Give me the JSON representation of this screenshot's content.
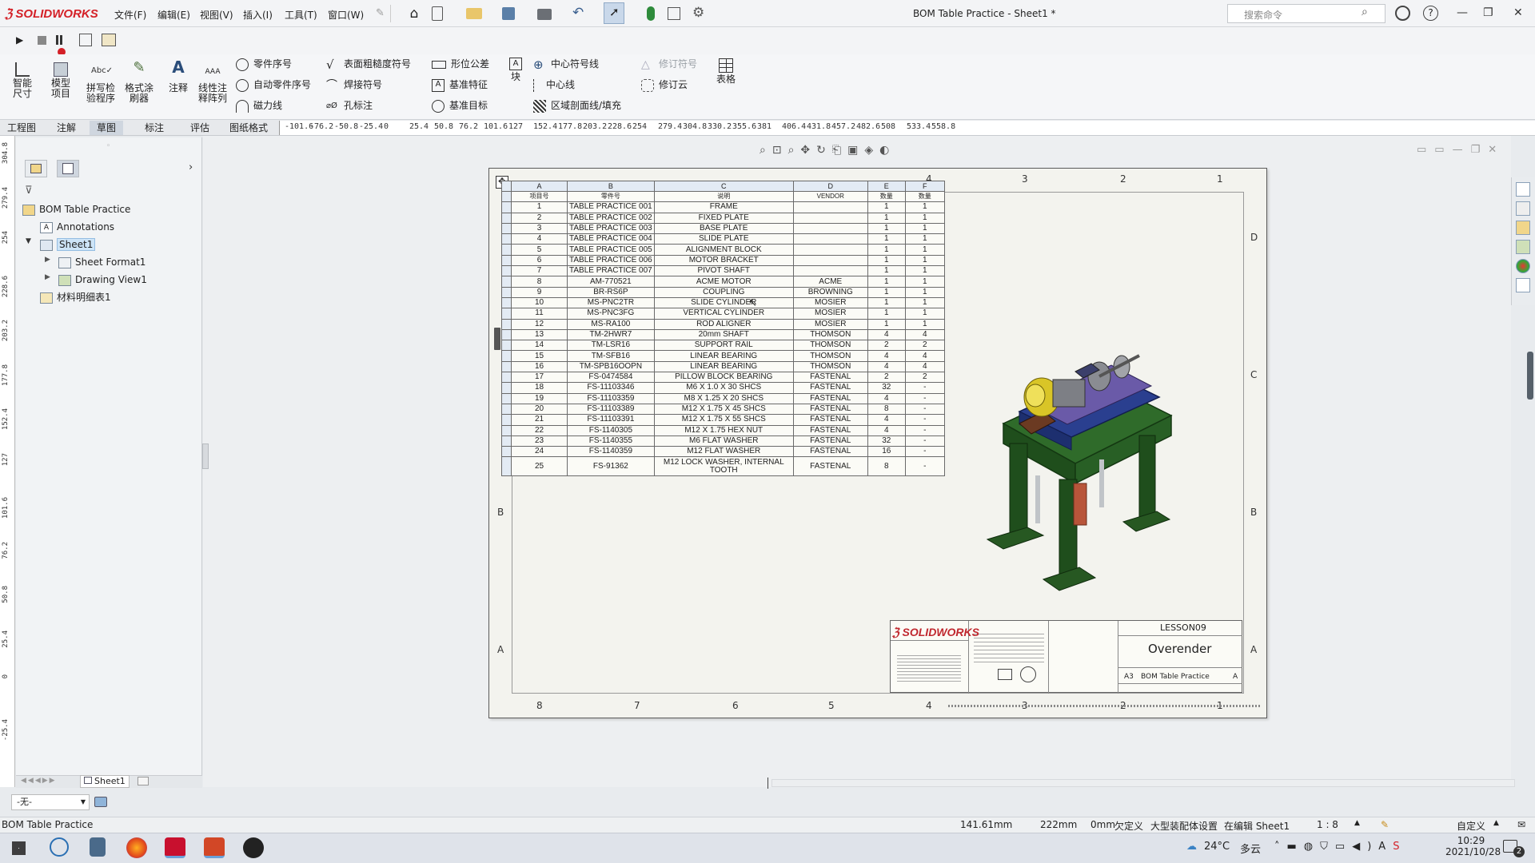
{
  "app": {
    "logo": "SOLIDWORKS",
    "title": "BOM Table Practice - Sheet1 *"
  },
  "menu": [
    "文件(F)",
    "编辑(E)",
    "视图(V)",
    "插入(I)",
    "工具(T)",
    "窗口(W)"
  ],
  "search": {
    "placeholder": "搜索命令"
  },
  "window_controls": [
    "—",
    "❐",
    "✕"
  ],
  "ribbon": {
    "big": [
      "智能尺寸",
      "模型项目",
      "拼写检验程序",
      "格式涂刷器",
      "注释",
      "线性注释阵列"
    ],
    "col1": [
      "零件序号",
      "自动零件序号",
      "磁力线"
    ],
    "col2": [
      "表面粗糙度符号",
      "焊接符号",
      "孔标注"
    ],
    "col3": [
      "形位公差",
      "基准特征",
      "基准目标"
    ],
    "block": "块",
    "col4": [
      "中心符号线",
      "中心线",
      "区域剖面线/填充"
    ],
    "col5": [
      "修订符号",
      "修订云"
    ],
    "table": "表格"
  },
  "tabs": [
    "工程图",
    "注解",
    "草图",
    "标注",
    "评估",
    "图纸格式"
  ],
  "ruler_h": [
    "-101.6",
    "-76.2",
    "-50.8",
    "-25.4",
    "0",
    "25.4",
    "50.8",
    "76.2",
    "101.6",
    "127",
    "152.4",
    "177.8",
    "203.2",
    "228.6",
    "254",
    "279.4",
    "304.8",
    "330.2",
    "355.6",
    "381",
    "406.4",
    "431.8",
    "457.2",
    "482.6",
    "508",
    "533.4",
    "558.8"
  ],
  "ruler_v": [
    "304.8",
    "279.4",
    "254",
    "228.6",
    "203.2",
    "177.8",
    "152.4",
    "127",
    "101.6",
    "76.2",
    "50.8",
    "25.4",
    "0",
    "-25.4"
  ],
  "tree": {
    "root": "BOM Table Practice",
    "annotations": "Annotations",
    "sheet": "Sheet1",
    "sheet_format": "Sheet Format1",
    "drawing_view": "Drawing View1",
    "bom": "材料明细表1"
  },
  "fm_bottom": {
    "sheet_tab": "Sheet1",
    "combo": "-无-"
  },
  "sheet_zones": {
    "top": [
      "8",
      "7",
      "6",
      "5",
      "4",
      "3",
      "2",
      "1"
    ],
    "rows": [
      "D",
      "C",
      "B",
      "A"
    ]
  },
  "bom": {
    "letters": [
      "A",
      "B",
      "C",
      "D",
      "E",
      "F"
    ],
    "headers": [
      "项目号",
      "零件号",
      "说明",
      "VENDOR",
      "数量",
      "数量"
    ],
    "rows": [
      [
        "1",
        "TABLE PRACTICE 001",
        "FRAME",
        "",
        "1",
        "1"
      ],
      [
        "2",
        "TABLE PRACTICE 002",
        "FIXED PLATE",
        "",
        "1",
        "1"
      ],
      [
        "3",
        "TABLE PRACTICE 003",
        "BASE PLATE",
        "",
        "1",
        "1"
      ],
      [
        "4",
        "TABLE PRACTICE 004",
        "SLIDE PLATE",
        "",
        "1",
        "1"
      ],
      [
        "5",
        "TABLE PRACTICE 005",
        "ALIGNMENT BLOCK",
        "",
        "1",
        "1"
      ],
      [
        "6",
        "TABLE PRACTICE 006",
        "MOTOR BRACKET",
        "",
        "1",
        "1"
      ],
      [
        "7",
        "TABLE PRACTICE 007",
        "PIVOT SHAFT",
        "",
        "1",
        "1"
      ],
      [
        "8",
        "AM-770521",
        "ACME MOTOR",
        "ACME",
        "1",
        "1"
      ],
      [
        "9",
        "BR-RS6P",
        "COUPLING",
        "BROWNING",
        "1",
        "1"
      ],
      [
        "10",
        "MS-PNC2TR",
        "SLIDE CYLINDER",
        "MOSIER",
        "1",
        "1"
      ],
      [
        "11",
        "MS-PNC3FG",
        "VERTICAL CYLINDER",
        "MOSIER",
        "1",
        "1"
      ],
      [
        "12",
        "MS-RA100",
        "ROD ALIGNER",
        "MOSIER",
        "1",
        "1"
      ],
      [
        "13",
        "TM-2HWR7",
        "20mm SHAFT",
        "THOMSON",
        "4",
        "4"
      ],
      [
        "14",
        "TM-LSR16",
        "SUPPORT RAIL",
        "THOMSON",
        "2",
        "2"
      ],
      [
        "15",
        "TM-SFB16",
        "LINEAR BEARING",
        "THOMSON",
        "4",
        "4"
      ],
      [
        "16",
        "TM-SPB16OOPN",
        "LINEAR BEARING",
        "THOMSON",
        "4",
        "4"
      ],
      [
        "17",
        "FS-0474584",
        "PILLOW BLOCK BEARING",
        "FASTENAL",
        "2",
        "2"
      ],
      [
        "18",
        "FS-11103346",
        "M6 X 1.0 X 30 SHCS",
        "FASTENAL",
        "32",
        "-"
      ],
      [
        "19",
        "FS-11103359",
        "M8 X 1.25 X 20 SHCS",
        "FASTENAL",
        "4",
        "-"
      ],
      [
        "20",
        "FS-11103389",
        "M12 X 1.75 X 45 SHCS",
        "FASTENAL",
        "8",
        "-"
      ],
      [
        "21",
        "FS-11103391",
        "M12 X 1.75 X 55 SHCS",
        "FASTENAL",
        "4",
        "-"
      ],
      [
        "22",
        "FS-1140305",
        "M12 X 1.75 HEX NUT",
        "FASTENAL",
        "4",
        "-"
      ],
      [
        "23",
        "FS-1140355",
        "M6 FLAT WASHER",
        "FASTENAL",
        "32",
        "-"
      ],
      [
        "24",
        "FS-1140359",
        "M12 FLAT WASHER",
        "FASTENAL",
        "16",
        "-"
      ],
      [
        "25",
        "FS-91362",
        "M12 LOCK WASHER, INTERNAL TOOTH",
        "FASTENAL",
        "8",
        "-"
      ]
    ]
  },
  "titleblock": {
    "logo": "SOLIDWORKS",
    "number": "LESSON09",
    "name": "Overender",
    "title": "BOM Table Practice",
    "size": "A3",
    "rev": "A"
  },
  "status": {
    "doc": "BOM Table Practice",
    "x": "141.61mm",
    "y": "222mm",
    "z": "0mm",
    "state": "欠定义",
    "mode": "大型装配体设置",
    "edit": "在编辑 Sheet1",
    "scale": "1 : 8",
    "custom": "自定义"
  },
  "taskbar": {
    "temp": "24°C",
    "weather": "多云",
    "time": "10:29",
    "date": "2021/10/28",
    "notifications": "2"
  },
  "colors": {
    "brand": "#d42027",
    "selection": "#cde4f7",
    "sheet": "#f3f3ee"
  }
}
